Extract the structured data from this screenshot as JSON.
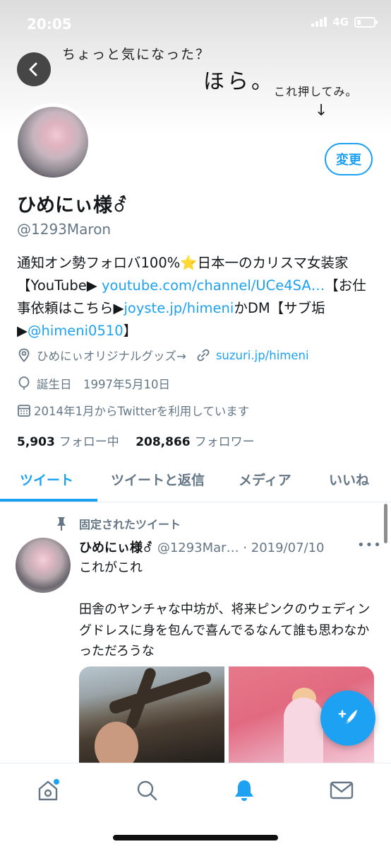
{
  "status_bar": {
    "time": "20:05",
    "network": "4G"
  },
  "banner": {
    "line1": "ちょっと気になった？",
    "line2": "ほら。",
    "line3": "これ押してみ。",
    "arrow": "↓"
  },
  "profile": {
    "edit_button": "変更",
    "display_name": "ひめにぃ様⚦",
    "handle": "@1293Maron",
    "bio": {
      "p1": "通知オン勢フォロバ100%⭐日本一のカリスマ女装家【YouTube▶ ",
      "link1": "youtube.com/channel/UCe4SA…",
      "p2": "【お仕事依頼はこちら▶",
      "link2": "joyste.jp/himeni",
      "p3": "かDM【サブ垢▶",
      "link3": "@himeni0510",
      "p4": "】"
    },
    "location": "ひめにぃオリジナルグッズ→",
    "website": "suzuri.jp/himeni",
    "birthday": "誕生日　1997年5月10日",
    "joined": "2014年1月からTwitterを利用しています",
    "following_count": "5,903",
    "following_label": "フォロー中",
    "followers_count": "208,866",
    "followers_label": "フォロワー"
  },
  "tabs": [
    {
      "label": "ツイート"
    },
    {
      "label": "ツイートと返信"
    },
    {
      "label": "メディア"
    },
    {
      "label": "いいね"
    }
  ],
  "tweet": {
    "pinned_label": "固定されたツイート",
    "name": "ひめにぃ様⚦",
    "meta": " @1293Mar… · 2019/07/10",
    "more": "•••",
    "text": "これがこれ\n\n田舎のヤンチャな中坊が、将来ピンクのウェディングドレスに身を包んで喜んでるなんて誰も思わなかっただろうな"
  },
  "colors": {
    "accent": "#1da1f2",
    "secondary_text": "#657786"
  },
  "icons": [
    "back-arrow-icon",
    "location-icon",
    "link-icon",
    "balloon-icon",
    "calendar-icon",
    "pin-icon",
    "compose-icon",
    "home-icon",
    "search-icon",
    "bell-icon",
    "mail-icon"
  ]
}
